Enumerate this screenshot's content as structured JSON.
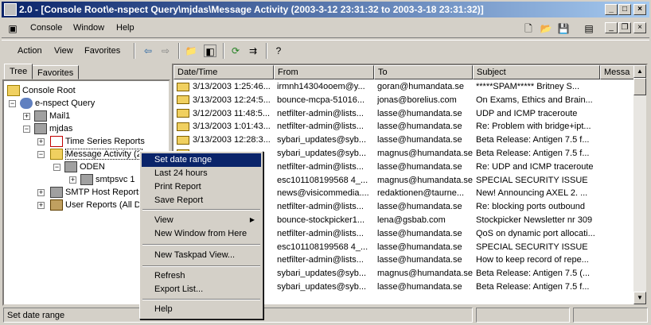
{
  "window": {
    "title": "2.0 - [Console Root\\e-nspect Query\\mjdas\\Message Activity (2003-3-12 23:31:32 to 2003-3-18 23:31:32)]",
    "minimize": "_",
    "maximize": "□",
    "close": "×"
  },
  "menubar": {
    "items": [
      "Console",
      "Window",
      "Help"
    ]
  },
  "toolbar": {
    "items": [
      "Action",
      "View",
      "Favorites"
    ]
  },
  "tabs": [
    "Tree",
    "Favorites"
  ],
  "tree": {
    "nodes": [
      "Console Root",
      "e-nspect Query",
      "Mail1",
      "mjdas",
      "Time Series Reports",
      "Message Activity (2",
      "ODEN",
      "smtpsvc 1",
      "SMTP Host Reports",
      "User Reports (All D"
    ]
  },
  "list": {
    "columns": [
      "Date/Time",
      "From",
      "To",
      "Subject",
      "Messa"
    ],
    "rows": [
      [
        "3/13/2003 1:25:46...",
        "irmnh14304ooem@y...",
        "goran@humandata.se",
        "*****SPAM***** Britney S..."
      ],
      [
        "3/13/2003 12:24:5...",
        "bounce-mcpa-51016...",
        "jonas@borelius.com",
        "On Exams, Ethics and Brain..."
      ],
      [
        "3/12/2003 11:48:5...",
        "netfilter-admin@lists...",
        "lasse@humandata.se",
        "UDP and ICMP traceroute"
      ],
      [
        "3/13/2003 1:01:43...",
        "netfilter-admin@lists...",
        "lasse@humandata.se",
        "Re: Problem with bridge+ipt..."
      ],
      [
        "3/13/2003 12:28:3...",
        "sybari_updates@syb...",
        "lasse@humandata.se",
        "Beta Release: Antigen 7.5 f..."
      ],
      [
        "",
        "sybari_updates@syb...",
        "magnus@humandata.se",
        "Beta Release: Antigen 7.5 f..."
      ],
      [
        "",
        "netfilter-admin@lists...",
        "lasse@humandata.se",
        "Re: UDP and ICMP traceroute"
      ],
      [
        "",
        "esc101108199568 4_...",
        "magnus@humandata.se",
        "SPECIAL SECURITY ISSUE"
      ],
      [
        "",
        "news@visicommedia....",
        "redaktionen@taurne...",
        "New!  Announcing AXEL 2. ..."
      ],
      [
        "",
        "netfilter-admin@lists...",
        "lasse@humandata.se",
        "Re: blocking ports outbound"
      ],
      [
        "",
        "bounce-stockpicker1...",
        "lena@gsbab.com",
        "Stockpicker Newsletter nr 309"
      ],
      [
        "",
        "netfilter-admin@lists...",
        "lasse@humandata.se",
        "QoS on dynamic port allocati..."
      ],
      [
        "",
        "esc101108199568 4_...",
        "lasse@humandata.se",
        "SPECIAL SECURITY ISSUE"
      ],
      [
        "",
        "netfilter-admin@lists...",
        "lasse@humandata.se",
        "How to keep record of repe..."
      ],
      [
        "",
        "sybari_updates@syb...",
        "magnus@humandata.se",
        "Beta Release: Antigen 7.5 (..."
      ],
      [
        "",
        "sybari_updates@syb...",
        "lasse@humandata.se",
        "Beta Release: Antigen 7.5 f..."
      ]
    ]
  },
  "context_menu": {
    "items": [
      "Set date range",
      "Last 24 hours",
      "Print Report",
      "Save Report",
      "View",
      "New Window from Here",
      "New Taskpad View...",
      "Refresh",
      "Export List...",
      "Help"
    ]
  },
  "status": {
    "text": "Set date range"
  }
}
